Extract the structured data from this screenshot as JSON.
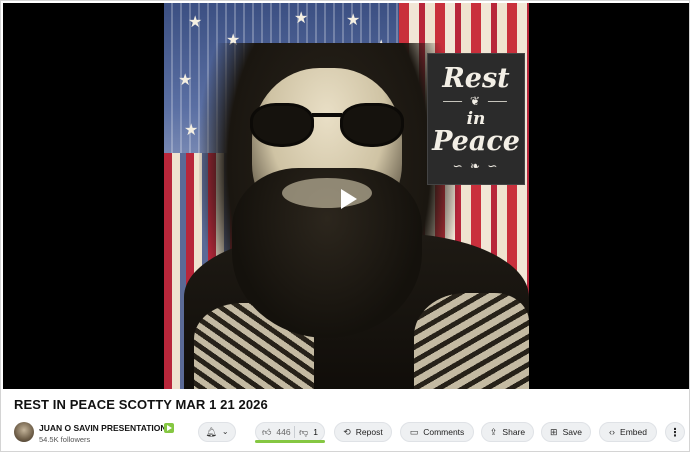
{
  "video": {
    "overlay_text": [
      "Rest",
      "in",
      "Peace"
    ],
    "play_icon": "play-icon"
  },
  "title": "REST IN PEACE SCOTTY MAR 1 21 2026",
  "channel": {
    "name": "JUAN O SAVIN PRESENTATIONS",
    "followers": "54.5K followers",
    "verified_icon": "verified-badge-icon",
    "verified_color": "#85c742"
  },
  "actions": {
    "bell_icon": "bell-icon",
    "chevron_icon": "chevron-down-icon",
    "likes": "446",
    "dislikes": "1",
    "like_ratio": 0.998,
    "repost": "Repost",
    "comments": "Comments",
    "share": "Share",
    "save": "Save",
    "embed": "Embed",
    "more_icon": "more-vertical-icon"
  },
  "colors": {
    "accent": "#85c742",
    "pill_bg": "#eef0f2",
    "player_bg": "#000000"
  }
}
